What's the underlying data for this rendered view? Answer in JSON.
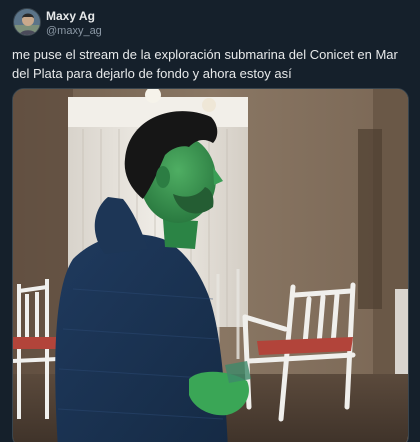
{
  "tweet": {
    "author": {
      "display_name": "Maxy Ag",
      "handle": "@maxy_ag",
      "avatar_icon": "user-avatar-icon"
    },
    "text": "me puse el stream de la exploración submarina del Conicet en Mar del Plata para dejarlo de fondo y ahora estoy así",
    "media": {
      "type": "photo",
      "accent_colors": {
        "wall": "#7d6a58",
        "curtain": "#e6e2da",
        "person_tint": "#2f8f4a",
        "chair": "#eeeeee",
        "cushion": "#b2443a"
      }
    }
  },
  "theme": {
    "background": "#15202b",
    "border": "#38444d",
    "text_primary": "#e7e9ea",
    "text_secondary": "#8b98a5"
  }
}
